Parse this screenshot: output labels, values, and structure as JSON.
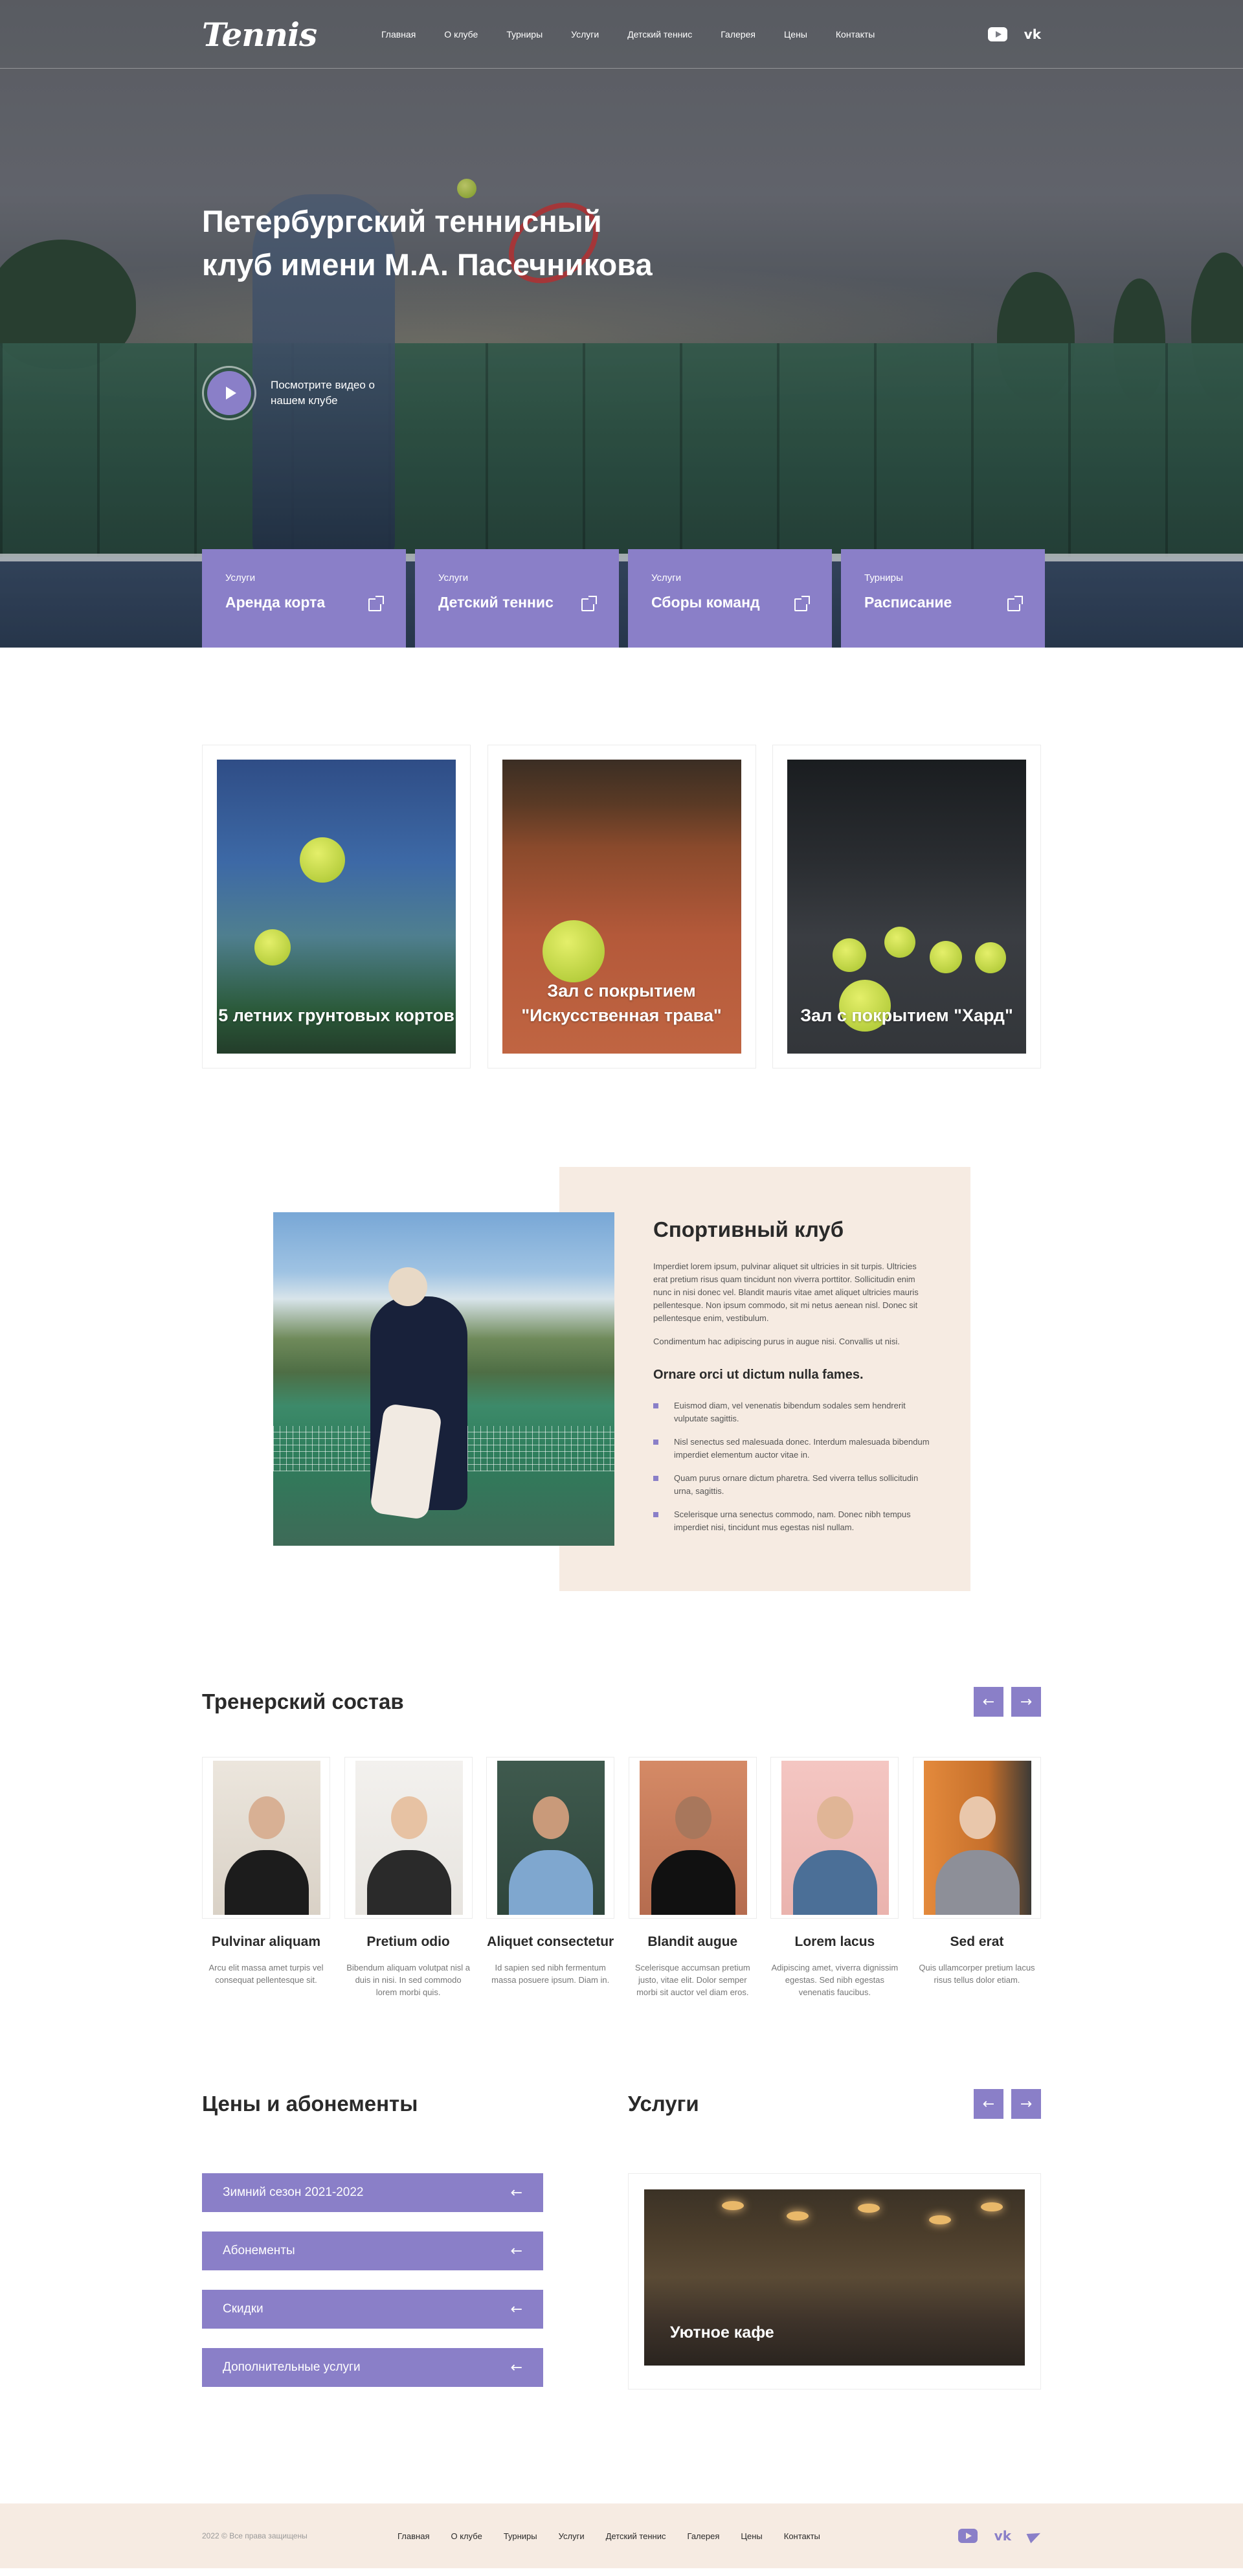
{
  "header": {
    "logo": "Tennis",
    "nav": [
      "Главная",
      "О клубе",
      "Турниры",
      "Услуги",
      "Детский теннис",
      "Галерея",
      "Цены",
      "Контакты"
    ]
  },
  "hero": {
    "title": "Петербургский теннисный клуб имени М.А. Пасечникова",
    "video_label": "Посмотрите видео о нашем клубе",
    "cards": [
      {
        "category": "Услуги",
        "title": "Аренда корта"
      },
      {
        "category": "Услуги",
        "title": "Детский теннис"
      },
      {
        "category": "Услуги",
        "title": "Сборы команд"
      },
      {
        "category": "Турниры",
        "title": "Расписание"
      }
    ]
  },
  "courts": [
    {
      "caption": "5 летних грунтовых кортов"
    },
    {
      "caption": "Зал с покрытием \"Искусственная трава\""
    },
    {
      "caption": "Зал с покрытием \"Хард\""
    }
  ],
  "club": {
    "title": "Спортивный клуб",
    "p1": "Imperdiet lorem ipsum, pulvinar aliquet sit ultricies in sit turpis. Ultricies erat pretium risus quam tincidunt non viverra porttitor. Sollicitudin enim nunc in nisi donec vel. Blandit mauris vitae amet aliquet ultricies mauris pellentesque. Non ipsum commodo, sit mi netus aenean nisl. Donec sit pellentesque enim, vestibulum.",
    "p2": "Condimentum hac adipiscing purus in augue nisi. Convallis ut nisi.",
    "subtitle": "Ornare orci ut dictum nulla fames.",
    "bullets": [
      "Euismod diam, vel venenatis bibendum sodales sem hendrerit vulputate sagittis.",
      "Nisl senectus sed malesuada donec. Interdum malesuada bibendum imperdiet elementum auctor vitae in.",
      "Quam purus ornare dictum pharetra. Sed viverra tellus sollicitudin urna, sagittis.",
      "Scelerisque urna senectus commodo, nam. Donec nibh tempus imperdiet nisi, tincidunt mus egestas nisl nullam."
    ]
  },
  "trainers": {
    "title": "Тренерский состав",
    "prev": "←",
    "next": "→",
    "items": [
      {
        "name": "Pulvinar aliquam",
        "desc": "Arcu elit massa amet turpis vel consequat pellentesque sit."
      },
      {
        "name": "Pretium odio",
        "desc": "Bibendum aliquam volutpat nisl a duis in nisi. In sed commodo lorem morbi quis."
      },
      {
        "name": "Aliquet consectetur",
        "desc": "Id sapien sed nibh fermentum massa posuere ipsum. Diam in."
      },
      {
        "name": "Blandit augue",
        "desc": "Scelerisque accumsan pretium justo, vitae elit. Dolor semper morbi sit auctor vel diam eros."
      },
      {
        "name": "Lorem lacus",
        "desc": "Adipiscing amet, viverra dignissim egestas. Sed nibh egestas venenatis faucibus."
      },
      {
        "name": "Sed erat",
        "desc": "Quis ullamcorper pretium lacus risus tellus dolor etiam."
      }
    ]
  },
  "prices": {
    "title": "Цены и абонементы",
    "items": [
      "Зимний сезон 2021-2022",
      "Абонементы",
      "Скидки",
      "Дополнительные услуги"
    ],
    "arrow": "←"
  },
  "services": {
    "title": "Услуги",
    "prev": "←",
    "next": "→",
    "card_caption": "Уютное кафе"
  },
  "footer": {
    "copyright": "2022 © Все права защищены",
    "nav": [
      "Главная",
      "О клубе",
      "Турниры",
      "Услуги",
      "Детский теннис",
      "Галерея",
      "Цены",
      "Контакты"
    ]
  },
  "colors": {
    "accent": "#8a7fc8",
    "beige": "#f6ebe2"
  },
  "icons": [
    "youtube-icon",
    "vk-icon",
    "telegram-icon",
    "play-icon",
    "external-link-icon",
    "arrow-left-icon",
    "arrow-right-icon"
  ]
}
